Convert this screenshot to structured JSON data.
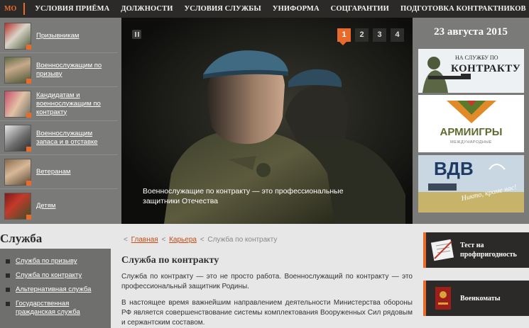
{
  "topnav": {
    "brand": "МО РФ",
    "items": [
      "УСЛОВИЯ ПРИЁМА",
      "ДОЛЖНОСТИ",
      "УСЛОВИЯ СЛУЖБЫ",
      "УНИФОРМА",
      "СОЦГАРАНТИИ",
      "ПОДГОТОВКА КОНТРАКТНИКОВ"
    ]
  },
  "leftmenu": {
    "items": [
      {
        "label": "Призывникам"
      },
      {
        "label": "Военнослужащим по призыву"
      },
      {
        "label": "Кандидатам и военнослужащим по контракту"
      },
      {
        "label": "Военнослужащим запаса и в отставке"
      },
      {
        "label": "Ветеранам"
      },
      {
        "label": "Детям"
      }
    ]
  },
  "hero": {
    "pages": [
      "1",
      "2",
      "3",
      "4"
    ],
    "active_page": "1",
    "caption": "Военнослужащие по контракту — это профессиональные защитники Отечества"
  },
  "rightcol": {
    "date": "23 августа 2015",
    "banner1": {
      "line1": "НА СЛУЖБУ ПО",
      "line2": "КОНТРАКТУ"
    },
    "banner2": {
      "title": "АРМИИГРЫ",
      "subtitle": "МЕЖДУНАРОДНЫЕ"
    },
    "banner3": {
      "title": "ВДВ",
      "slogan": "Никто, кроме нас!"
    }
  },
  "lower": {
    "section_title": "Служба",
    "sidemenu": [
      "Служба по призыву",
      "Служба по контракту",
      "Альтернативная служба",
      "Государственная гражданская служба"
    ],
    "breadcrumb": {
      "home": "Главная",
      "career": "Карьера",
      "current": "Служба по контракту",
      "separator": "<"
    },
    "title": "Служба по контракту",
    "paragraph1": "Служба по контракту — это не просто работа. Военнослужащий по контракту — это профессиональный защитник Родины.",
    "paragraph2": "В настоящее время важнейшим направлением деятельности Министерства обороны РФ является совершенствование системы комплектования Вооруженных Сил рядовым и сержантским составом.",
    "right_buttons": [
      "Тест на профпригодность",
      "Военкоматы"
    ]
  },
  "colors": {
    "accent": "#e86b2c",
    "nav_bg": "#2b2a29",
    "menu_bg": "#7a7a78"
  }
}
